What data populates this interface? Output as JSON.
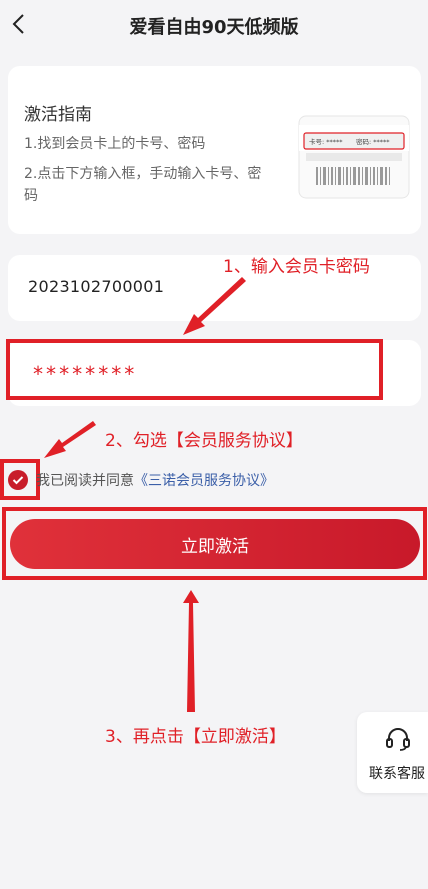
{
  "header": {
    "title": "爱看自由90天低频版"
  },
  "guide": {
    "title": "激活指南",
    "step1": "1.找到会员卡上的卡号、密码",
    "step2": "2.点击下方输入框，手动输入卡号、密码",
    "card_number_label": "卡号: *****",
    "card_password_label": "密码: *****"
  },
  "form": {
    "card_number_value": "2023102700001",
    "password_value": "********"
  },
  "agreement": {
    "text": "我已阅读并同意",
    "link": "《三诺会员服务协议》"
  },
  "activate_button": {
    "label": "立即激活"
  },
  "annotations": {
    "step1": "1、输入会员卡密码",
    "step2": "2、勾选【会员服务协议】",
    "step3": "3、再点击【立即激活】"
  },
  "customer_service": {
    "label": "联系客服",
    "icon": "headset-icon"
  },
  "colors": {
    "accent": "#e02027",
    "button": "#d42230",
    "link": "#3b5fa8",
    "background": "#f4f4f6"
  }
}
